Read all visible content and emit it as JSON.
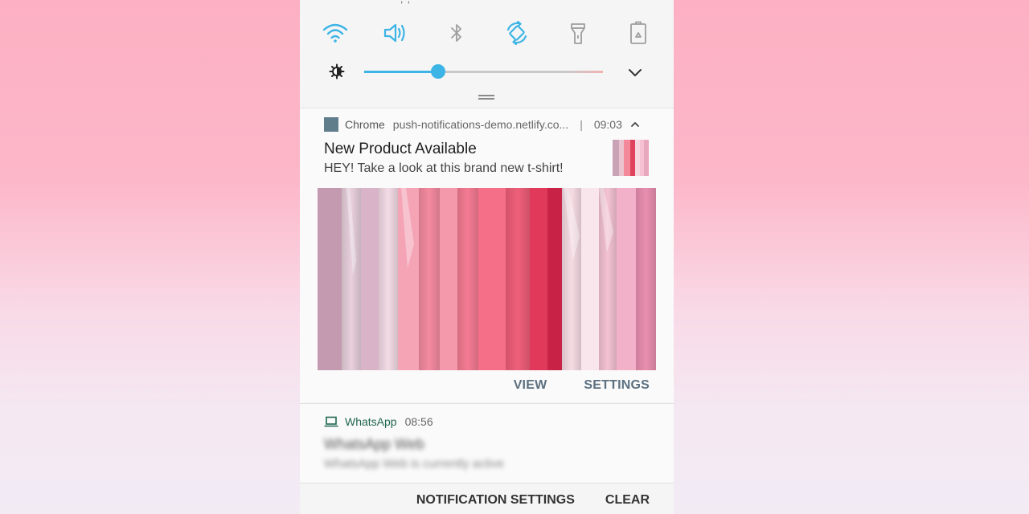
{
  "quick_settings": {
    "icons": [
      "wifi-icon",
      "volume-icon",
      "bluetooth-icon",
      "auto-rotate-icon",
      "flashlight-icon",
      "power-saving-icon"
    ],
    "active_color": "#3cb4e6",
    "inactive_color": "#9e9e9e"
  },
  "brightness": {
    "icon": "brightness-icon",
    "level": 0.31
  },
  "chrome_notification": {
    "app_name": "Chrome",
    "site": "push-notifications-demo.netlify.co...",
    "separator": "|",
    "time": "09:03",
    "title": "New Product Available",
    "body": "HEY! Take a look at this brand new t-shirt!",
    "actions": [
      "VIEW",
      "SETTINGS"
    ],
    "action_color": "#5c7080"
  },
  "whatsapp_notification": {
    "app_name": "WhatsApp",
    "time": "08:56",
    "title": "WhatsApp Web",
    "body": "WhatsApp Web is currently active"
  },
  "footer": {
    "notification_settings": "NOTIFICATION SETTINGS",
    "clear": "CLEAR"
  }
}
